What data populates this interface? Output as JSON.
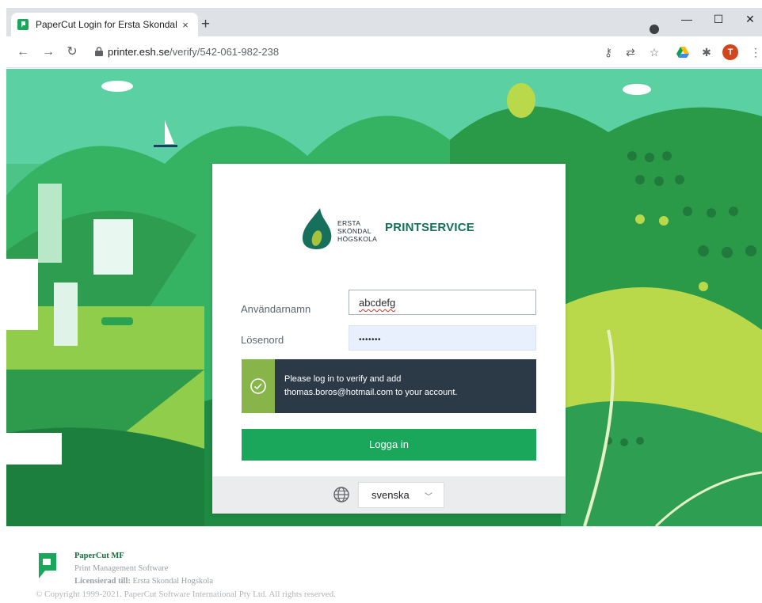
{
  "browser": {
    "tab_title": "PaperCut Login for Ersta Skondal",
    "tab_close": "×",
    "new_tab": "+",
    "url_host": "printer.esh.se",
    "url_path": "/verify/542-061-982-238",
    "profile_initial": "T",
    "min": "—",
    "max": "☐",
    "close": "✕"
  },
  "login": {
    "brand_lines": [
      "ERSTA",
      "SKÖNDAL",
      "HÖGSKOLA"
    ],
    "brand_title": "PRINTSERVICE",
    "username_label": "Användarnamn",
    "username_value": "abcdefg",
    "password_label": "Lösenord",
    "password_value": "•••••••",
    "notice_line1": "Please log in to verify and add",
    "notice_line2": "thomas.boros@hotmail.com to your account.",
    "login_button": "Logga in",
    "language": "svenska"
  },
  "footer": {
    "product": "PaperCut MF",
    "tagline": "Print Management Software",
    "licensed_label": "Licensierad till:",
    "licensed_to": " Ersta Skondal Hogskola",
    "copyright": "© Copyright 1999-2021. PaperCut Software International Pty Ltd. All rights reserved."
  },
  "colors": {
    "primary_green": "#1aa75c",
    "notice_bg": "#2c3a48",
    "notice_accent": "#87b54a",
    "brand_teal": "#14705a"
  }
}
